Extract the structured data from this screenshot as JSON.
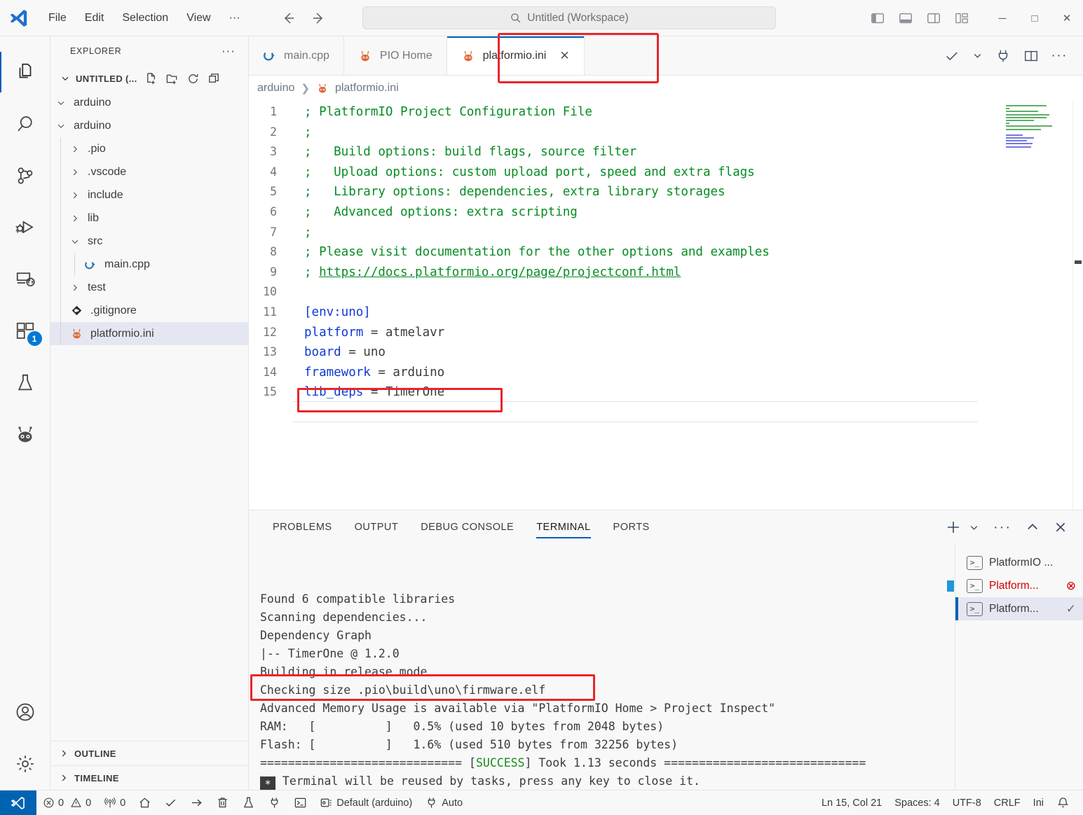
{
  "titlebar": {
    "menus": [
      "File",
      "Edit",
      "Selection",
      "View",
      "···"
    ],
    "search_text": "Untitled (Workspace)",
    "search_icon": "search-icon",
    "back_icon": "arrow-left-icon",
    "forward_icon": "arrow-right-icon",
    "layout_icons": [
      "toggle-primary-sidebar-icon",
      "toggle-panel-icon",
      "toggle-secondary-sidebar-icon",
      "customize-layout-icon"
    ],
    "window_buttons": {
      "minimize": "─",
      "maximize": "□",
      "close": "✕"
    }
  },
  "activitybar": {
    "items": [
      {
        "name": "explorer",
        "active": true
      },
      {
        "name": "search",
        "active": false
      },
      {
        "name": "source-control",
        "active": false
      },
      {
        "name": "run-and-debug",
        "active": false
      },
      {
        "name": "remote-explorer",
        "active": false
      },
      {
        "name": "extensions",
        "active": false,
        "badge": "1"
      },
      {
        "name": "testing",
        "active": false
      },
      {
        "name": "platformio",
        "active": false
      }
    ],
    "bottom": [
      {
        "name": "accounts"
      },
      {
        "name": "settings"
      }
    ]
  },
  "sidebar": {
    "title": "EXPLORER",
    "more_icon": "more-actions-icon",
    "root": {
      "label": "UNTITLED (...",
      "chevron": "chevron-down-icon",
      "actions": [
        "new-file-icon",
        "new-folder-icon",
        "refresh-icon",
        "collapse-all-icon"
      ]
    },
    "tree": [
      {
        "label": "arduino",
        "indent": 1,
        "type": "folder",
        "expanded": true
      },
      {
        "label": "arduino",
        "indent": 1,
        "type": "folder",
        "expanded": true
      },
      {
        "label": ".pio",
        "indent": 2,
        "type": "folder",
        "expanded": false
      },
      {
        "label": ".vscode",
        "indent": 2,
        "type": "folder",
        "expanded": false
      },
      {
        "label": "include",
        "indent": 2,
        "type": "folder",
        "expanded": false
      },
      {
        "label": "lib",
        "indent": 2,
        "type": "folder",
        "expanded": false
      },
      {
        "label": "src",
        "indent": 2,
        "type": "folder",
        "expanded": true
      },
      {
        "label": "main.cpp",
        "indent": 3,
        "type": "cpp"
      },
      {
        "label": "test",
        "indent": 2,
        "type": "folder",
        "expanded": false
      },
      {
        "label": ".gitignore",
        "indent": 2,
        "type": "git"
      },
      {
        "label": "platformio.ini",
        "indent": 2,
        "type": "pio",
        "selected": true
      }
    ],
    "sections": [
      {
        "label": "OUTLINE",
        "chevron": "chevron-right-icon"
      },
      {
        "label": "TIMELINE",
        "chevron": "chevron-right-icon"
      }
    ]
  },
  "editor": {
    "tabs": [
      {
        "label": "main.cpp",
        "icon": "cpp-file-icon",
        "active": false,
        "closable": false
      },
      {
        "label": "PIO Home",
        "icon": "platformio-icon",
        "active": false,
        "closable": false
      },
      {
        "label": "platformio.ini",
        "icon": "platformio-icon",
        "active": true,
        "closable": true,
        "highlighted": true
      }
    ],
    "close_glyph": "✕",
    "actions": [
      "run-check-icon",
      "chevron-down-icon",
      "plug-icon",
      "split-editor-icon",
      "more-actions-icon"
    ],
    "breadcrumb": {
      "folder": "arduino",
      "separator": "❯",
      "file": "platformio.ini",
      "icon": "platformio-icon"
    },
    "lines": [
      {
        "n": 1,
        "tokens": [
          {
            "t": "; PlatformIO Project Configuration File",
            "c": "comment"
          }
        ]
      },
      {
        "n": 2,
        "tokens": [
          {
            "t": ";",
            "c": "comment"
          }
        ]
      },
      {
        "n": 3,
        "tokens": [
          {
            "t": ";   Build options: build flags, source filter",
            "c": "comment"
          }
        ]
      },
      {
        "n": 4,
        "tokens": [
          {
            "t": ";   Upload options: custom upload port, speed and extra flags",
            "c": "comment"
          }
        ]
      },
      {
        "n": 5,
        "tokens": [
          {
            "t": ";   Library options: dependencies, extra library storages",
            "c": "comment"
          }
        ]
      },
      {
        "n": 6,
        "tokens": [
          {
            "t": ";   Advanced options: extra scripting",
            "c": "comment"
          }
        ]
      },
      {
        "n": 7,
        "tokens": [
          {
            "t": ";",
            "c": "comment"
          }
        ]
      },
      {
        "n": 8,
        "tokens": [
          {
            "t": "; Please visit documentation for the other options and examples",
            "c": "comment"
          }
        ]
      },
      {
        "n": 9,
        "tokens": [
          {
            "t": "; ",
            "c": "comment"
          },
          {
            "t": "https://docs.platformio.org/page/projectconf.html",
            "c": "link"
          }
        ]
      },
      {
        "n": 10,
        "tokens": []
      },
      {
        "n": 11,
        "tokens": [
          {
            "t": "[env:uno]",
            "c": "sect"
          }
        ]
      },
      {
        "n": 12,
        "tokens": [
          {
            "t": "platform",
            "c": "key"
          },
          {
            "t": " = atmelavr",
            "c": "val"
          }
        ]
      },
      {
        "n": 13,
        "tokens": [
          {
            "t": "board",
            "c": "key"
          },
          {
            "t": " = uno",
            "c": "val"
          }
        ]
      },
      {
        "n": 14,
        "tokens": [
          {
            "t": "framework",
            "c": "key"
          },
          {
            "t": " = arduino",
            "c": "val"
          }
        ]
      },
      {
        "n": 15,
        "tokens": [
          {
            "t": "lib_deps",
            "c": "key"
          },
          {
            "t": " = TimerOne",
            "c": "val"
          }
        ],
        "highlighted": true
      }
    ]
  },
  "panel": {
    "tabs": [
      {
        "label": "PROBLEMS",
        "active": false
      },
      {
        "label": "OUTPUT",
        "active": false
      },
      {
        "label": "DEBUG CONSOLE",
        "active": false
      },
      {
        "label": "TERMINAL",
        "active": true
      },
      {
        "label": "PORTS",
        "active": false
      }
    ],
    "actions": [
      "new-terminal-icon",
      "chevron-down-icon",
      "more-actions-icon",
      "maximize-panel-icon",
      "close-panel-icon"
    ],
    "terminal_lines": [
      {
        "text": "Found 6 compatible libraries"
      },
      {
        "text": "Scanning dependencies..."
      },
      {
        "text": "Dependency Graph"
      },
      {
        "text": "|-- TimerOne @ 1.2.0"
      },
      {
        "text": "Building in release mode"
      },
      {
        "text": "Checking size .pio\\build\\uno\\firmware.elf",
        "highlighted": true
      },
      {
        "text": "Advanced Memory Usage is available via \"PlatformIO Home > Project Inspect\""
      },
      {
        "text": "RAM:   [          ]   0.5% (used 10 bytes from 2048 bytes)"
      },
      {
        "text": "Flash: [          ]   1.6% (used 510 bytes from 32256 bytes)"
      },
      {
        "pre": "============================= [",
        "success": "SUCCESS",
        "post": "] Took 1.13 seconds ============================="
      },
      {
        "star": "*",
        "text": " Terminal will be reused by tasks, press any key to close it."
      }
    ],
    "terminal_list": [
      {
        "label": "PlatformIO ...",
        "icon": "terminal-icon",
        "status": "",
        "selected": false
      },
      {
        "label": "Platform...",
        "icon": "terminal-icon",
        "status": "⊗",
        "selected": false,
        "error": true
      },
      {
        "label": "Platform...",
        "icon": "terminal-icon",
        "status": "✓",
        "selected": true
      }
    ]
  },
  "statusbar": {
    "left": [
      {
        "name": "remote-indicator",
        "icon": "vscode-logo-icon",
        "label": ""
      },
      {
        "name": "problems",
        "icon": "error-icon",
        "label": "0",
        "icon2": "warning-icon",
        "label2": "0"
      },
      {
        "name": "ports-forwarded",
        "icon": "radio-tower-icon",
        "label": "0"
      },
      {
        "name": "pio-home",
        "icon": "home-icon",
        "label": ""
      },
      {
        "name": "pio-build",
        "icon": "check-icon",
        "label": ""
      },
      {
        "name": "pio-upload",
        "icon": "arrow-right-icon",
        "label": ""
      },
      {
        "name": "pio-clean",
        "icon": "trash-icon",
        "label": ""
      },
      {
        "name": "pio-test",
        "icon": "beaker-icon",
        "label": ""
      },
      {
        "name": "pio-serial-monitor",
        "icon": "plug-icon",
        "label": ""
      },
      {
        "name": "pio-new-terminal",
        "icon": "terminal-icon",
        "label": ""
      },
      {
        "name": "pio-project-env",
        "icon": "board-icon",
        "label": "Default (arduino)"
      },
      {
        "name": "pio-upload-port",
        "icon": "plug-icon",
        "label": "Auto"
      }
    ],
    "right": [
      {
        "name": "editor-position",
        "label": "Ln 15, Col 21"
      },
      {
        "name": "editor-indentation",
        "label": "Spaces: 4"
      },
      {
        "name": "editor-encoding",
        "label": "UTF-8"
      },
      {
        "name": "editor-eol",
        "label": "CRLF"
      },
      {
        "name": "editor-language",
        "label": "Ini"
      },
      {
        "name": "notifications",
        "icon": "bell-icon",
        "label": ""
      }
    ]
  },
  "colors": {
    "accent": "#005fb8",
    "highlight_box": "#e8262a",
    "selection": "#e4e6f1",
    "comment": "#068c22",
    "keyword": "#0d39d6",
    "success": "#1a8c1a",
    "error": "#d40000",
    "badge": "#0078d4"
  }
}
